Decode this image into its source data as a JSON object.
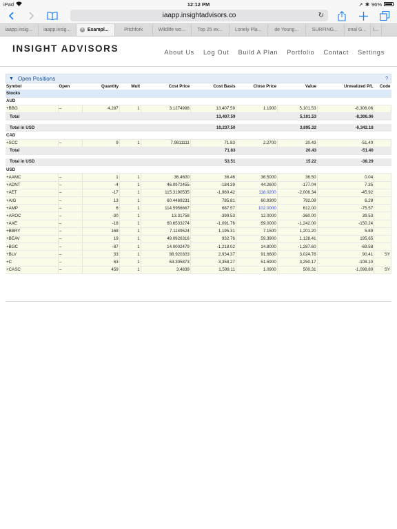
{
  "status": {
    "carrier": "iPad",
    "time": "12:12 PM",
    "battery": "96%"
  },
  "browser": {
    "url": "iaapp.insightadvisors.co",
    "tabs": [
      {
        "label": "iaapp.insig...",
        "active": false
      },
      {
        "label": "iaapp.insig...",
        "active": false
      },
      {
        "label": "Exampl...",
        "active": true
      },
      {
        "label": "Pitchfork",
        "active": false
      },
      {
        "label": "Wildlife wo...",
        "active": false
      },
      {
        "label": "Top 25 ex...",
        "active": false
      },
      {
        "label": "Lonely Pla...",
        "active": false
      },
      {
        "label": "de Young...",
        "active": false
      },
      {
        "label": "SURFING...",
        "active": false
      },
      {
        "label": "onal G...",
        "active": false
      },
      {
        "label": "I...",
        "active": false
      }
    ]
  },
  "site": {
    "brand": "INSIGHT ADVISORS",
    "nav": [
      "About Us",
      "Log Out",
      "Build A Plan",
      "Portfolio",
      "Contact",
      "Settings"
    ]
  },
  "panel": {
    "title": "Open Positions",
    "help": "?"
  },
  "table": {
    "headers": [
      "Symbol",
      "Open",
      "Quantity",
      "Mult",
      "Cost Price",
      "Cost Basis",
      "Close Price",
      "Value",
      "Unrealized P/L",
      "Code"
    ],
    "group_label": "Stocks",
    "sections": [
      {
        "currency": "AUD",
        "rows": [
          [
            "+BBG",
            "–",
            "4,287",
            "1",
            "3.1274998",
            "13,407.59",
            "1.1900",
            "5,101.53",
            "-8,306.06",
            ""
          ]
        ],
        "total": {
          "label": "Total",
          "cost_basis": "13,407.59",
          "value": "5,101.53",
          "pl": "-8,306.06"
        },
        "usd_total": {
          "label": "Total in USD",
          "cost_basis": "10,237.50",
          "value": "3,895.32",
          "pl": "-6,342.18"
        }
      },
      {
        "currency": "CAD",
        "rows": [
          [
            "+SCC",
            "–",
            "9",
            "1",
            "7.9811111",
            "71.83",
            "2.2700",
            "20.43",
            "-51.40",
            ""
          ]
        ],
        "total": {
          "label": "Total",
          "cost_basis": "71.83",
          "value": "20.43",
          "pl": "-51.40"
        },
        "usd_total": {
          "label": "Total in USD",
          "cost_basis": "53.51",
          "value": "15.22",
          "pl": "-38.29"
        }
      },
      {
        "currency": "USD",
        "rows": [
          [
            "+AAMC",
            "–",
            "1",
            "1",
            "36.4600",
            "36.46",
            "36.5000",
            "36.50",
            "0.04",
            ""
          ],
          [
            "+ADNT",
            "–",
            "-4",
            "1",
            "46.0972455",
            "-184.39",
            "44.2600",
            "-177.04",
            "7.35",
            ""
          ],
          [
            "+AET",
            "–",
            "-17",
            "1",
            "115.3190535",
            "-1,960.42",
            "118.0200",
            "-2,006.34",
            "-45.92",
            ""
          ],
          [
            "+AIG",
            "–",
            "13",
            "1",
            "60.4469231",
            "785.81",
            "60.9300",
            "792.09",
            "6.28",
            ""
          ],
          [
            "+AMP",
            "–",
            "6",
            "1",
            "114.5956667",
            "687.57",
            "102.0000",
            "612.00",
            "-75.57",
            ""
          ],
          [
            "+AROC",
            "–",
            "-30",
            "1",
            "13.31758",
            "-399.53",
            "12.0000",
            "-360.00",
            "39.53",
            ""
          ],
          [
            "+AXE",
            "–",
            "-18",
            "1",
            "60.6533274",
            "-1,091.76",
            "69.0000",
            "-1,242.00",
            "-150.24",
            ""
          ],
          [
            "+BBRY",
            "–",
            "168",
            "1",
            "7.1149524",
            "1,195.31",
            "7.1500",
            "1,201.20",
            "5.89",
            ""
          ],
          [
            "+BEAV",
            "–",
            "19",
            "1",
            "49.0926316",
            "932.76",
            "59.3900",
            "1,128.41",
            "195.65",
            ""
          ],
          [
            "+BGC",
            "–",
            "-87",
            "1",
            "14.0002479",
            "-1,218.02",
            "14.8000",
            "-1,287.60",
            "-69.58",
            ""
          ],
          [
            "+BLV",
            "–",
            "33",
            "1",
            "88.920303",
            "2,934.37",
            "91.6600",
            "3,024.78",
            "90.41",
            "SY"
          ],
          [
            "+C",
            "–",
            "63",
            "1",
            "53.305873",
            "3,358.27",
            "51.5900",
            "3,250.17",
            "-108.10",
            ""
          ],
          [
            "+CASC",
            "–",
            "459",
            "1",
            "3.4839",
            "1,599.11",
            "1.0900",
            "500.31",
            "-1,098.80",
            "SY"
          ]
        ],
        "blue_close_symbols": [
          "+AET",
          "+AMP"
        ]
      }
    ]
  },
  "colors": {
    "link_blue": "#1a7cf5",
    "panel_blue": "#e5eef8",
    "row_cream": "#fbfbea",
    "total_grey": "#ececec"
  }
}
